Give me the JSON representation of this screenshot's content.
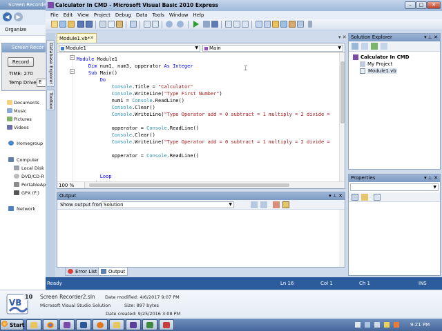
{
  "bg_explorer": {
    "title": "Screen Recorder",
    "organize": "Organize",
    "nav_items": [
      "Documents",
      "Music",
      "Pictures",
      "Videos",
      "Homegroup",
      "Computer",
      "Local Disk (",
      "DVD/CD-R",
      "PortableAp",
      "GPX (F:)",
      "Network"
    ]
  },
  "recorder": {
    "title": "Screen Recor",
    "record_label": "Record",
    "time_label": "TIME: 270",
    "drive_label": "Temp Drive:",
    "drive_value": "E"
  },
  "vs": {
    "title": "Calculator In CMD - Microsoft Visual Basic 2010 Express",
    "menu": [
      "File",
      "Edit",
      "View",
      "Project",
      "Debug",
      "Data",
      "Tools",
      "Window",
      "Help"
    ],
    "side_tabs": [
      "Database Explorer",
      "Toolbox"
    ],
    "doc_tab": "Module1.vb*",
    "nav_left": "Module1",
    "nav_right": "Main",
    "zoom": "100 %",
    "code": [
      {
        "parts": [
          {
            "t": "Module ",
            "c": "kw"
          },
          {
            "t": "Module1",
            "c": ""
          }
        ]
      },
      {
        "parts": [
          {
            "t": "    Dim ",
            "c": "kw"
          },
          {
            "t": "num1, num3, opperator ",
            "c": ""
          },
          {
            "t": "As Integer",
            "c": "kw"
          }
        ]
      },
      {
        "parts": [
          {
            "t": "    Sub ",
            "c": "kw"
          },
          {
            "t": "Main()",
            "c": ""
          }
        ]
      },
      {
        "parts": [
          {
            "t": "        Do",
            "c": "kw"
          }
        ]
      },
      {
        "parts": [
          {
            "t": "            Console",
            "c": "ty"
          },
          {
            "t": ".Title = ",
            "c": ""
          },
          {
            "t": "\"Calculator\"",
            "c": "str"
          }
        ]
      },
      {
        "parts": [
          {
            "t": "            Console",
            "c": "ty"
          },
          {
            "t": ".WriteLine(",
            "c": ""
          },
          {
            "t": "\"Type First Number\"",
            "c": "str"
          },
          {
            "t": ")",
            "c": ""
          }
        ]
      },
      {
        "parts": [
          {
            "t": "            num1 = ",
            "c": ""
          },
          {
            "t": "Console",
            "c": "ty"
          },
          {
            "t": ".ReadLine()",
            "c": ""
          }
        ]
      },
      {
        "parts": [
          {
            "t": "            Console",
            "c": "ty"
          },
          {
            "t": ".Clear()",
            "c": ""
          }
        ]
      },
      {
        "parts": [
          {
            "t": "            Console",
            "c": "ty"
          },
          {
            "t": ".WriteLine(",
            "c": ""
          },
          {
            "t": "\"Type Operator add = 0 subtract = 1 multiply = 2 divide =",
            "c": "str"
          }
        ]
      },
      {
        "parts": [
          {
            "t": "",
            "c": ""
          }
        ]
      },
      {
        "parts": [
          {
            "t": "            opperator = ",
            "c": ""
          },
          {
            "t": "Console",
            "c": "ty"
          },
          {
            "t": ".ReadLine()",
            "c": ""
          }
        ]
      },
      {
        "parts": [
          {
            "t": "            Console",
            "c": "ty"
          },
          {
            "t": ".Clear()",
            "c": ""
          }
        ]
      },
      {
        "parts": [
          {
            "t": "            Console",
            "c": "ty"
          },
          {
            "t": ".WriteLine(",
            "c": ""
          },
          {
            "t": "\"Type Operator add = 0 subtract = 1 multiply = 2 divide =",
            "c": "str"
          }
        ]
      },
      {
        "parts": [
          {
            "t": "",
            "c": ""
          }
        ]
      },
      {
        "parts": [
          {
            "t": "            opperator = ",
            "c": ""
          },
          {
            "t": "Console",
            "c": "ty"
          },
          {
            "t": ".ReadLine()",
            "c": ""
          }
        ]
      },
      {
        "parts": [
          {
            "t": "",
            "c": ""
          }
        ]
      },
      {
        "parts": [
          {
            "t": "",
            "c": ""
          }
        ]
      },
      {
        "parts": [
          {
            "t": "        Loop",
            "c": "kw"
          }
        ]
      },
      {
        "parts": [
          {
            "t": "    End Sub",
            "c": "kw"
          }
        ]
      }
    ],
    "output": {
      "title": "Output",
      "show_from_label": "Show output from:",
      "show_from_value": "Solution"
    },
    "bottom_tabs": [
      "Error List",
      "Output"
    ],
    "solution_explorer": {
      "title": "Solution Explorer",
      "nodes": [
        "Calculator In CMD",
        "My Project",
        "Module1.vb"
      ]
    },
    "properties": {
      "title": "Properties"
    },
    "status": {
      "ready": "Ready",
      "line": "Ln 16",
      "col": "Col 1",
      "ch": "Ch 1",
      "mode": "INS"
    }
  },
  "details": {
    "badge": "10",
    "file_name": "Screen Recorder2.sln",
    "file_type": "Microsoft Visual Studio Solution",
    "modified": "Date modified: 4/6/2017 9:07 PM",
    "size": "Size: 897 bytes",
    "created": "Date created: 9/25/2016 3:08 PM"
  },
  "taskbar": {
    "start_label": "Start",
    "time": "9:21 PM"
  }
}
